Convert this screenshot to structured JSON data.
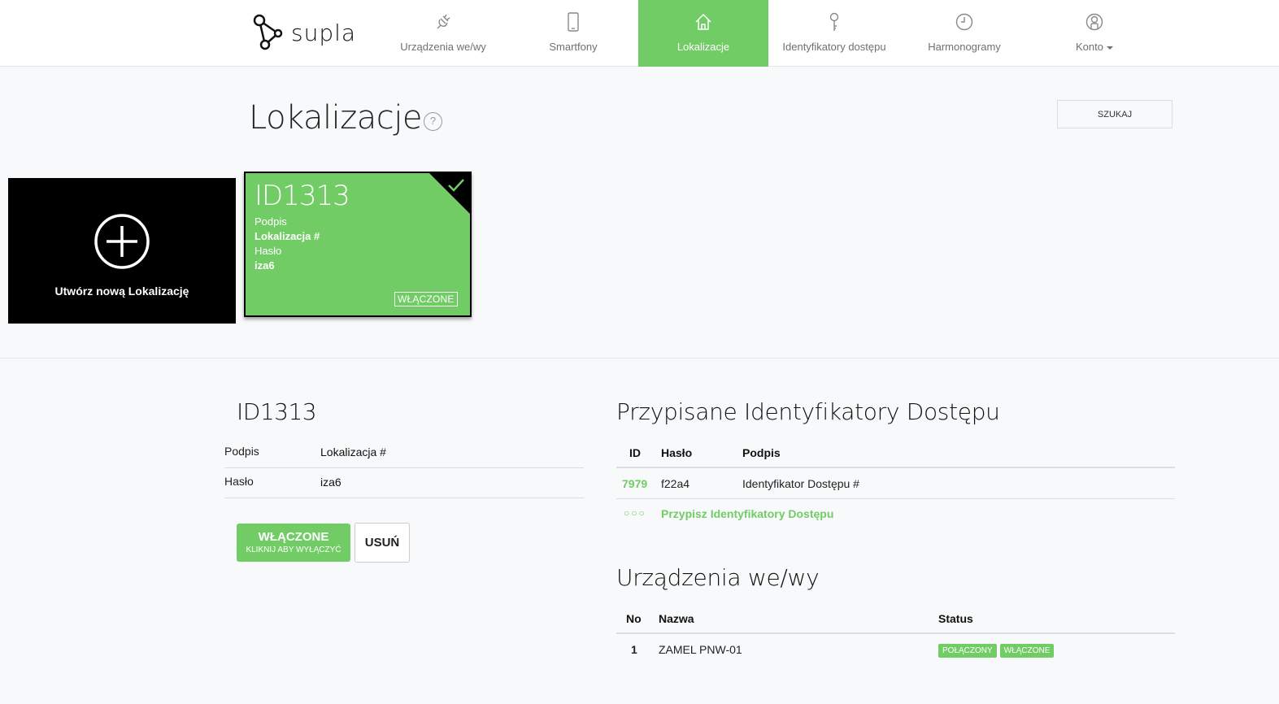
{
  "brand": {
    "name": "supla",
    "accent": "#72cc66"
  },
  "nav": [
    {
      "label": "Urządzenia we/wy",
      "icon": "plug-icon",
      "active": false
    },
    {
      "label": "Smartfony",
      "icon": "smartphone-icon",
      "active": false
    },
    {
      "label": "Lokalizacje",
      "icon": "home-icon",
      "active": true
    },
    {
      "label": "Identyfikatory dostępu",
      "icon": "key-icon",
      "active": false
    },
    {
      "label": "Harmonogramy",
      "icon": "clock-icon",
      "active": false
    },
    {
      "label": "Konto",
      "icon": "user-icon",
      "active": false,
      "dropdown": true
    }
  ],
  "page": {
    "title": "Lokalizacje",
    "help": "?",
    "search_label": "SZUKAJ"
  },
  "new_tile": {
    "label": "Utwórz nową Lokalizację"
  },
  "location_tile": {
    "id": "ID1313",
    "caption_label": "Podpis",
    "caption_value": "Lokalizacja #",
    "password_label": "Hasło",
    "password_value": "iza6",
    "status": "WŁĄCZONE"
  },
  "details": {
    "title": "ID1313",
    "rows": [
      {
        "label": "Podpis",
        "value": "Lokalizacja #"
      },
      {
        "label": "Hasło",
        "value": "iza6"
      }
    ],
    "toggle_label": "WŁĄCZONE",
    "toggle_hint": "KLIKNIJ ABY WYŁĄCZYĆ",
    "delete_label": "USUŃ"
  },
  "access_ids": {
    "title": "Przypisane Identyfikatory Dostępu",
    "columns": [
      "ID",
      "Hasło",
      "Podpis"
    ],
    "rows": [
      {
        "id": "7979",
        "password": "f22a4",
        "caption": "Identyfikator Dostępu #"
      }
    ],
    "assign_dots": "○○○",
    "assign_label": "Przypisz Identyfikatory Dostępu"
  },
  "devices": {
    "title": "Urządzenia we/wy",
    "columns": [
      "No",
      "Nazwa",
      "Status"
    ],
    "rows": [
      {
        "no": "1",
        "name": "ZAMEL PNW-01",
        "status": [
          "POŁĄCZONY",
          "WŁĄCZONE"
        ]
      }
    ]
  }
}
